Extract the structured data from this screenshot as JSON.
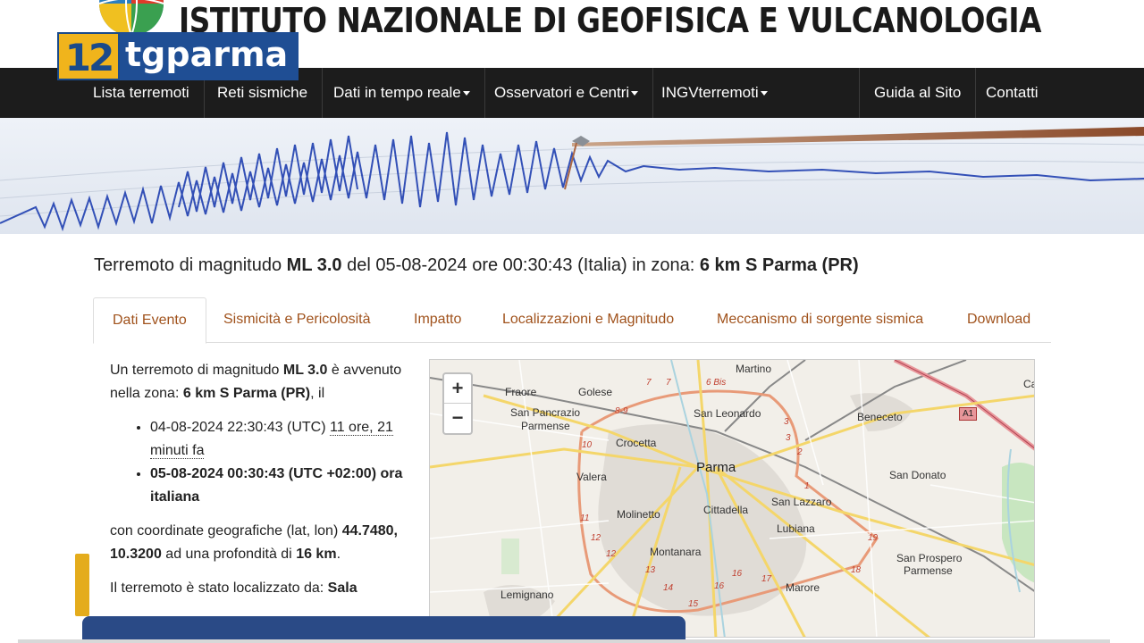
{
  "header": {
    "site_title": "ISTITUTO NAZIONALE DI GEOFISICA E VULCANOLOGIA"
  },
  "tv_logo": {
    "number": "12",
    "name": "tgparma"
  },
  "nav": {
    "items": [
      {
        "label": "Lista terremoti",
        "dropdown": false
      },
      {
        "label": "Reti sismiche",
        "dropdown": false
      },
      {
        "label": "Dati in tempo reale",
        "dropdown": true
      },
      {
        "label": "Osservatori e Centri",
        "dropdown": true
      },
      {
        "label": "INGVterremoti",
        "dropdown": true
      },
      {
        "label": "Guida al Sito",
        "dropdown": false
      },
      {
        "label": "Contatti",
        "dropdown": false
      }
    ]
  },
  "event": {
    "title_prefix": "Terremoto di magnitudo ",
    "magnitude": "ML 3.0",
    "title_mid": " del 05-08-2024 ore 00:30:43 (Italia) in zona: ",
    "zone": "6 km S Parma (PR)"
  },
  "tabs": [
    {
      "label": "Dati Evento",
      "active": true
    },
    {
      "label": "Sismicità e Pericolosità",
      "active": false
    },
    {
      "label": "Impatto",
      "active": false
    },
    {
      "label": "Localizzazioni e Magnitudo",
      "active": false
    },
    {
      "label": "Meccanismo di sorgente sismica",
      "active": false
    },
    {
      "label": "Download",
      "active": false
    }
  ],
  "details": {
    "intro_1": "Un terremoto di magnitudo ",
    "intro_mag": "ML 3.0",
    "intro_2": " è avvenuto nella zona: ",
    "intro_zone": "6 km S Parma (PR)",
    "intro_3": ", il",
    "utc_time": "04-08-2024 22:30:43 (UTC) ",
    "utc_ago": "11 ore, 21 minuti fa",
    "local_time": "05-08-2024 00:30:43 (UTC +02:00) ora italiana",
    "coords_1": "con coordinate geografiche (lat, lon) ",
    "coords_latlon": "44.7480, 10.3200",
    "coords_2": " ad una profondità di ",
    "coords_depth": "16 km",
    "coords_3": ".",
    "located_by_1": "Il terremoto è stato localizzato da: ",
    "located_by_2": "Sala"
  },
  "map": {
    "zoom_in": "+",
    "zoom_out": "−",
    "places": {
      "martino": "Martino",
      "fraore": "Fraore",
      "golese": "Golese",
      "san_pancrazio": "San Pancrazio",
      "parmense": "Parmense",
      "san_leonardo": "San Leonardo",
      "beneceto": "Beneceto",
      "ca": "Ca",
      "crocetta": "Crocetta",
      "parma": "Parma",
      "san_donato": "San Donato",
      "valera": "Valera",
      "san_lazzaro": "San Lazzaro",
      "molinetto": "Molinetto",
      "cittadella": "Cittadella",
      "lubiana": "Lubiana",
      "montanara": "Montanara",
      "san_prospero": "San Prospero",
      "parmense_2": "Parmense",
      "lemignano": "Lemignano",
      "marore": "Marore"
    },
    "motorway": "A1",
    "road_numbers": [
      "7",
      "7",
      "6 Bis",
      "8-9",
      "3",
      "10",
      "2",
      "1",
      "11",
      "12",
      "12",
      "13",
      "14",
      "15",
      "16",
      "17",
      "18",
      "19",
      "16",
      "3"
    ]
  }
}
